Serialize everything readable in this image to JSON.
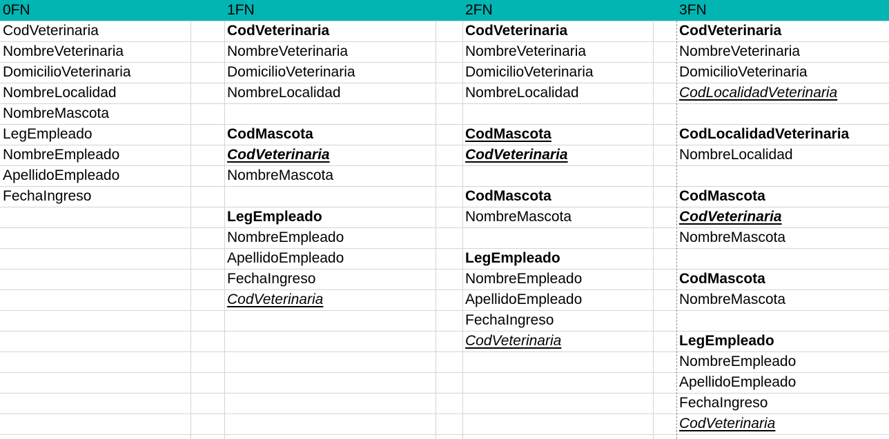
{
  "headers": [
    "0FN",
    "1FN",
    "2FN",
    "3FN"
  ],
  "columns": [
    {
      "cells": [
        {
          "row": 0,
          "text": "CodVeterinaria",
          "bold": false,
          "italic": false,
          "underline": false
        },
        {
          "row": 1,
          "text": "NombreVeterinaria",
          "bold": false,
          "italic": false,
          "underline": false
        },
        {
          "row": 2,
          "text": "DomicilioVeterinaria",
          "bold": false,
          "italic": false,
          "underline": false
        },
        {
          "row": 3,
          "text": "NombreLocalidad",
          "bold": false,
          "italic": false,
          "underline": false
        },
        {
          "row": 4,
          "text": "NombreMascota",
          "bold": false,
          "italic": false,
          "underline": false
        },
        {
          "row": 5,
          "text": "LegEmpleado",
          "bold": false,
          "italic": false,
          "underline": false
        },
        {
          "row": 6,
          "text": "NombreEmpleado",
          "bold": false,
          "italic": false,
          "underline": false
        },
        {
          "row": 7,
          "text": "ApellidoEmpleado",
          "bold": false,
          "italic": false,
          "underline": false
        },
        {
          "row": 8,
          "text": "FechaIngreso",
          "bold": false,
          "italic": false,
          "underline": false
        }
      ]
    },
    {
      "cells": [
        {
          "row": 0,
          "text": "CodVeterinaria",
          "bold": true,
          "italic": false,
          "underline": false
        },
        {
          "row": 1,
          "text": "NombreVeterinaria",
          "bold": false,
          "italic": false,
          "underline": false
        },
        {
          "row": 2,
          "text": "DomicilioVeterinaria",
          "bold": false,
          "italic": false,
          "underline": false
        },
        {
          "row": 3,
          "text": "NombreLocalidad",
          "bold": false,
          "italic": false,
          "underline": false
        },
        {
          "row": 5,
          "text": "CodMascota",
          "bold": true,
          "italic": false,
          "underline": false
        },
        {
          "row": 6,
          "text": "CodVeterinaria",
          "bold": true,
          "italic": true,
          "underline": true
        },
        {
          "row": 7,
          "text": "NombreMascota",
          "bold": false,
          "italic": false,
          "underline": false
        },
        {
          "row": 9,
          "text": "LegEmpleado",
          "bold": true,
          "italic": false,
          "underline": false
        },
        {
          "row": 10,
          "text": "NombreEmpleado",
          "bold": false,
          "italic": false,
          "underline": false
        },
        {
          "row": 11,
          "text": "ApellidoEmpleado",
          "bold": false,
          "italic": false,
          "underline": false
        },
        {
          "row": 12,
          "text": "FechaIngreso",
          "bold": false,
          "italic": false,
          "underline": false
        },
        {
          "row": 13,
          "text": "CodVeterinaria",
          "bold": false,
          "italic": true,
          "underline": true
        }
      ]
    },
    {
      "cells": [
        {
          "row": 0,
          "text": "CodVeterinaria",
          "bold": true,
          "italic": false,
          "underline": false
        },
        {
          "row": 1,
          "text": "NombreVeterinaria",
          "bold": false,
          "italic": false,
          "underline": false
        },
        {
          "row": 2,
          "text": "DomicilioVeterinaria",
          "bold": false,
          "italic": false,
          "underline": false
        },
        {
          "row": 3,
          "text": "NombreLocalidad",
          "bold": false,
          "italic": false,
          "underline": false
        },
        {
          "row": 5,
          "text": "CodMascota",
          "bold": true,
          "italic": false,
          "underline": true
        },
        {
          "row": 6,
          "text": "CodVeterinaria",
          "bold": true,
          "italic": true,
          "underline": true
        },
        {
          "row": 8,
          "text": "CodMascota",
          "bold": true,
          "italic": false,
          "underline": false
        },
        {
          "row": 9,
          "text": "NombreMascota",
          "bold": false,
          "italic": false,
          "underline": false
        },
        {
          "row": 11,
          "text": "LegEmpleado",
          "bold": true,
          "italic": false,
          "underline": false
        },
        {
          "row": 12,
          "text": "NombreEmpleado",
          "bold": false,
          "italic": false,
          "underline": false
        },
        {
          "row": 13,
          "text": "ApellidoEmpleado",
          "bold": false,
          "italic": false,
          "underline": false
        },
        {
          "row": 14,
          "text": "FechaIngreso",
          "bold": false,
          "italic": false,
          "underline": false
        },
        {
          "row": 15,
          "text": "CodVeterinaria",
          "bold": false,
          "italic": true,
          "underline": true
        }
      ]
    },
    {
      "cells": [
        {
          "row": 0,
          "text": "CodVeterinaria",
          "bold": true,
          "italic": false,
          "underline": false
        },
        {
          "row": 1,
          "text": "NombreVeterinaria",
          "bold": false,
          "italic": false,
          "underline": false
        },
        {
          "row": 2,
          "text": "DomicilioVeterinaria",
          "bold": false,
          "italic": false,
          "underline": false
        },
        {
          "row": 3,
          "text": "CodLocalidadVeterinaria ",
          "bold": false,
          "italic": true,
          "underline": true
        },
        {
          "row": 5,
          "text": "CodLocalidadVeterinaria",
          "bold": true,
          "italic": false,
          "underline": false
        },
        {
          "row": 6,
          "text": "NombreLocalidad",
          "bold": false,
          "italic": false,
          "underline": false
        },
        {
          "row": 8,
          "text": "CodMascota",
          "bold": true,
          "italic": false,
          "underline": false
        },
        {
          "row": 9,
          "text": "CodVeterinaria",
          "bold": true,
          "italic": true,
          "underline": true
        },
        {
          "row": 10,
          "text": "NombreMascota",
          "bold": false,
          "italic": false,
          "underline": false
        },
        {
          "row": 12,
          "text": "CodMascota",
          "bold": true,
          "italic": false,
          "underline": false
        },
        {
          "row": 13,
          "text": "NombreMascota",
          "bold": false,
          "italic": false,
          "underline": false
        },
        {
          "row": 15,
          "text": "LegEmpleado",
          "bold": true,
          "italic": false,
          "underline": false
        },
        {
          "row": 16,
          "text": "NombreEmpleado",
          "bold": false,
          "italic": false,
          "underline": false
        },
        {
          "row": 17,
          "text": "ApellidoEmpleado",
          "bold": false,
          "italic": false,
          "underline": false
        },
        {
          "row": 18,
          "text": "FechaIngreso",
          "bold": false,
          "italic": false,
          "underline": false
        },
        {
          "row": 19,
          "text": "CodVeterinaria",
          "bold": false,
          "italic": true,
          "underline": true
        }
      ]
    }
  ],
  "colors": {
    "header_band": "#00b5b2",
    "grid": "#d4d4d4",
    "text": "#000000"
  }
}
